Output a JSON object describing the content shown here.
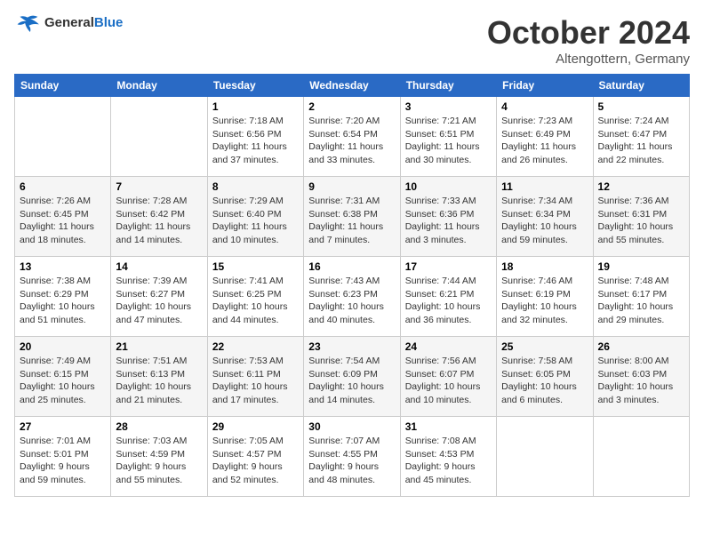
{
  "logo": {
    "general": "General",
    "blue": "Blue"
  },
  "header": {
    "month_title": "October 2024",
    "location": "Altengottern, Germany"
  },
  "weekdays": [
    "Sunday",
    "Monday",
    "Tuesday",
    "Wednesday",
    "Thursday",
    "Friday",
    "Saturday"
  ],
  "weeks": [
    [
      {
        "day": null,
        "info": null
      },
      {
        "day": null,
        "info": null
      },
      {
        "day": "1",
        "info": "Sunrise: 7:18 AM\nSunset: 6:56 PM\nDaylight: 11 hours and 37 minutes."
      },
      {
        "day": "2",
        "info": "Sunrise: 7:20 AM\nSunset: 6:54 PM\nDaylight: 11 hours and 33 minutes."
      },
      {
        "day": "3",
        "info": "Sunrise: 7:21 AM\nSunset: 6:51 PM\nDaylight: 11 hours and 30 minutes."
      },
      {
        "day": "4",
        "info": "Sunrise: 7:23 AM\nSunset: 6:49 PM\nDaylight: 11 hours and 26 minutes."
      },
      {
        "day": "5",
        "info": "Sunrise: 7:24 AM\nSunset: 6:47 PM\nDaylight: 11 hours and 22 minutes."
      }
    ],
    [
      {
        "day": "6",
        "info": "Sunrise: 7:26 AM\nSunset: 6:45 PM\nDaylight: 11 hours and 18 minutes."
      },
      {
        "day": "7",
        "info": "Sunrise: 7:28 AM\nSunset: 6:42 PM\nDaylight: 11 hours and 14 minutes."
      },
      {
        "day": "8",
        "info": "Sunrise: 7:29 AM\nSunset: 6:40 PM\nDaylight: 11 hours and 10 minutes."
      },
      {
        "day": "9",
        "info": "Sunrise: 7:31 AM\nSunset: 6:38 PM\nDaylight: 11 hours and 7 minutes."
      },
      {
        "day": "10",
        "info": "Sunrise: 7:33 AM\nSunset: 6:36 PM\nDaylight: 11 hours and 3 minutes."
      },
      {
        "day": "11",
        "info": "Sunrise: 7:34 AM\nSunset: 6:34 PM\nDaylight: 10 hours and 59 minutes."
      },
      {
        "day": "12",
        "info": "Sunrise: 7:36 AM\nSunset: 6:31 PM\nDaylight: 10 hours and 55 minutes."
      }
    ],
    [
      {
        "day": "13",
        "info": "Sunrise: 7:38 AM\nSunset: 6:29 PM\nDaylight: 10 hours and 51 minutes."
      },
      {
        "day": "14",
        "info": "Sunrise: 7:39 AM\nSunset: 6:27 PM\nDaylight: 10 hours and 47 minutes."
      },
      {
        "day": "15",
        "info": "Sunrise: 7:41 AM\nSunset: 6:25 PM\nDaylight: 10 hours and 44 minutes."
      },
      {
        "day": "16",
        "info": "Sunrise: 7:43 AM\nSunset: 6:23 PM\nDaylight: 10 hours and 40 minutes."
      },
      {
        "day": "17",
        "info": "Sunrise: 7:44 AM\nSunset: 6:21 PM\nDaylight: 10 hours and 36 minutes."
      },
      {
        "day": "18",
        "info": "Sunrise: 7:46 AM\nSunset: 6:19 PM\nDaylight: 10 hours and 32 minutes."
      },
      {
        "day": "19",
        "info": "Sunrise: 7:48 AM\nSunset: 6:17 PM\nDaylight: 10 hours and 29 minutes."
      }
    ],
    [
      {
        "day": "20",
        "info": "Sunrise: 7:49 AM\nSunset: 6:15 PM\nDaylight: 10 hours and 25 minutes."
      },
      {
        "day": "21",
        "info": "Sunrise: 7:51 AM\nSunset: 6:13 PM\nDaylight: 10 hours and 21 minutes."
      },
      {
        "day": "22",
        "info": "Sunrise: 7:53 AM\nSunset: 6:11 PM\nDaylight: 10 hours and 17 minutes."
      },
      {
        "day": "23",
        "info": "Sunrise: 7:54 AM\nSunset: 6:09 PM\nDaylight: 10 hours and 14 minutes."
      },
      {
        "day": "24",
        "info": "Sunrise: 7:56 AM\nSunset: 6:07 PM\nDaylight: 10 hours and 10 minutes."
      },
      {
        "day": "25",
        "info": "Sunrise: 7:58 AM\nSunset: 6:05 PM\nDaylight: 10 hours and 6 minutes."
      },
      {
        "day": "26",
        "info": "Sunrise: 8:00 AM\nSunset: 6:03 PM\nDaylight: 10 hours and 3 minutes."
      }
    ],
    [
      {
        "day": "27",
        "info": "Sunrise: 7:01 AM\nSunset: 5:01 PM\nDaylight: 9 hours and 59 minutes."
      },
      {
        "day": "28",
        "info": "Sunrise: 7:03 AM\nSunset: 4:59 PM\nDaylight: 9 hours and 55 minutes."
      },
      {
        "day": "29",
        "info": "Sunrise: 7:05 AM\nSunset: 4:57 PM\nDaylight: 9 hours and 52 minutes."
      },
      {
        "day": "30",
        "info": "Sunrise: 7:07 AM\nSunset: 4:55 PM\nDaylight: 9 hours and 48 minutes."
      },
      {
        "day": "31",
        "info": "Sunrise: 7:08 AM\nSunset: 4:53 PM\nDaylight: 9 hours and 45 minutes."
      },
      {
        "day": null,
        "info": null
      },
      {
        "day": null,
        "info": null
      }
    ]
  ]
}
